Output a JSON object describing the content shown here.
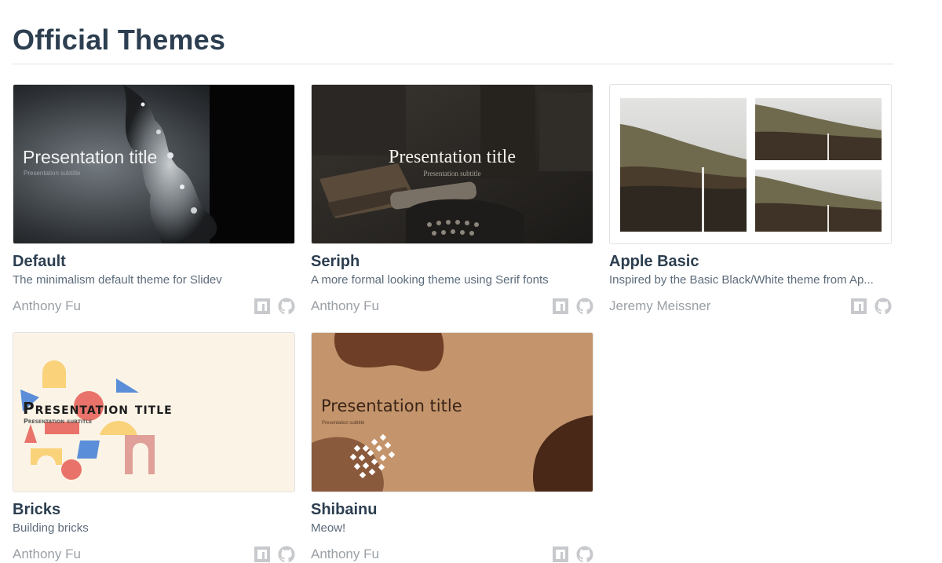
{
  "page": {
    "title": "Official Themes"
  },
  "themes": [
    {
      "name": "Default",
      "description": "The minimalism default theme for Slidev",
      "author": "Anthony Fu",
      "preview_title": "Presentation title",
      "preview_subtitle": "Presentation subtitle"
    },
    {
      "name": "Seriph",
      "description": "A more formal looking theme using Serif fonts",
      "author": "Anthony Fu",
      "preview_title": "Presentation title",
      "preview_subtitle": "Presentation subtitle"
    },
    {
      "name": "Apple Basic",
      "description": "Inspired by the Basic Black/White theme from Ap...",
      "author": "Jeremy Meissner"
    },
    {
      "name": "Bricks",
      "description": "Building bricks",
      "author": "Anthony Fu",
      "preview_title": "Presentation title",
      "preview_subtitle": "Presentation subtitle"
    },
    {
      "name": "Shibainu",
      "description": "Meow!",
      "author": "Anthony Fu",
      "preview_title": "Presentation title",
      "preview_subtitle": "Presentation subtitle"
    }
  ],
  "icons": {
    "npm": "npm-icon",
    "github": "github-icon"
  },
  "colors": {
    "heading": "#2c3e50",
    "text": "#5c6b7a",
    "muted": "#9aa0a6",
    "icon": "#c7c9cc",
    "bricks_bg": "#fbf4e6",
    "shibainu_bg": "#c4956c",
    "shibainu_dark": "#4a2818"
  }
}
